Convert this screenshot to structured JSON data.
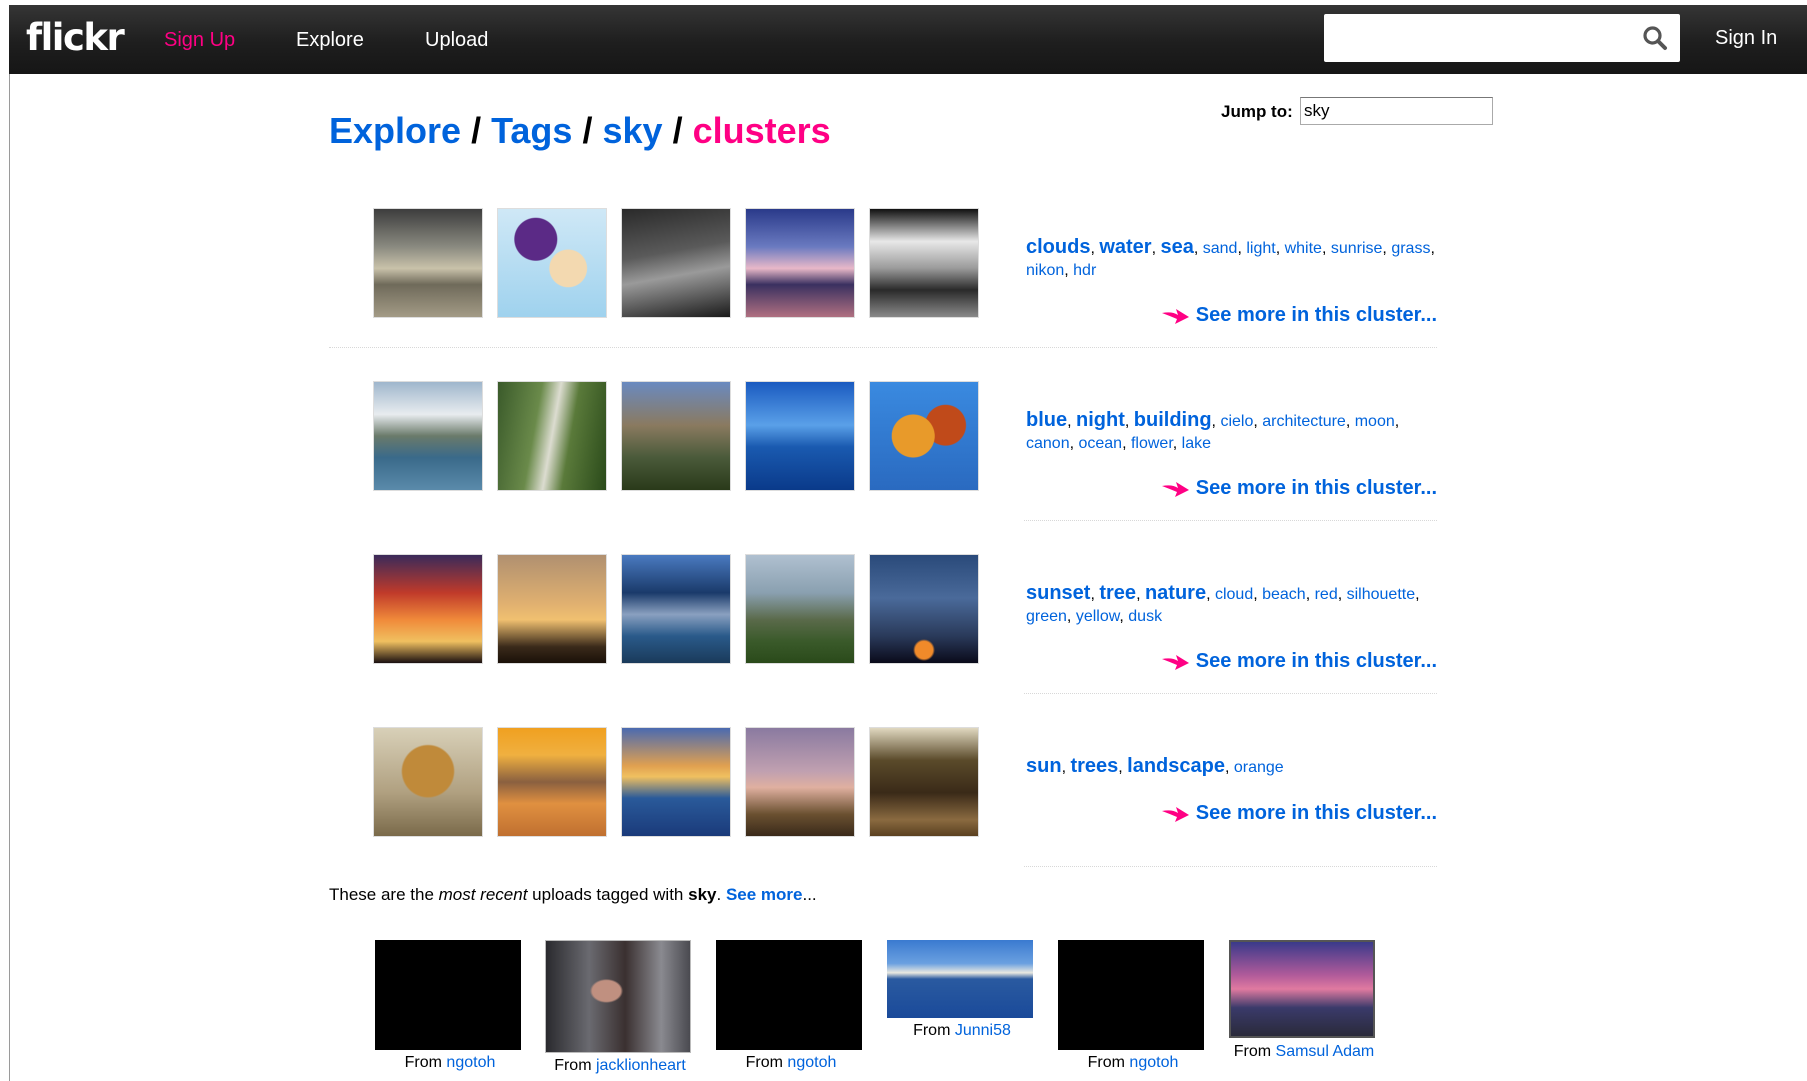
{
  "header": {
    "logo": "flickr",
    "nav": {
      "signup": "Sign Up",
      "explore": "Explore",
      "upload": "Upload"
    },
    "search": {
      "value": "",
      "placeholder": ""
    },
    "signin": "Sign In"
  },
  "title": {
    "explore": "Explore",
    "tags": "Tags",
    "sky": "sky",
    "clusters": "clusters",
    "sep": "/"
  },
  "jump": {
    "label": "Jump to:",
    "value": "sky"
  },
  "clusters": [
    {
      "tags_big": [
        "clouds",
        "water",
        "sea"
      ],
      "tags_small": [
        "sand",
        "light",
        "white",
        "sunrise",
        "grass",
        "nikon",
        "hdr"
      ],
      "see_more": "See more in this cluster..."
    },
    {
      "tags_big": [
        "blue",
        "night",
        "building"
      ],
      "tags_small": [
        "cielo",
        "architecture",
        "moon",
        "canon",
        "ocean",
        "flower",
        "lake"
      ],
      "see_more": "See more in this cluster..."
    },
    {
      "tags_big": [
        "sunset",
        "tree",
        "nature"
      ],
      "tags_small": [
        "cloud",
        "beach",
        "red",
        "silhouette",
        "green",
        "yellow",
        "dusk"
      ],
      "see_more": "See more in this cluster..."
    },
    {
      "tags_big": [
        "sun",
        "trees",
        "landscape"
      ],
      "tags_small": [
        "orange"
      ],
      "see_more": "See more in this cluster..."
    }
  ],
  "recent": {
    "prefix": "These are the ",
    "emph": "most recent",
    "middle": " uploads tagged with ",
    "tag": "sky",
    "dot": ". ",
    "see_more": "See more",
    "ellipsis": "...",
    "from_label": "From",
    "items": [
      {
        "user": "ngotoh"
      },
      {
        "user": "jacklionheart"
      },
      {
        "user": "ngotoh"
      },
      {
        "user": "Junni58"
      },
      {
        "user": "ngotoh"
      },
      {
        "user": "Samsul Adam"
      }
    ]
  },
  "colors": {
    "link": "#0063dc",
    "accent": "#ff0084",
    "header": "#1e1e1e"
  }
}
